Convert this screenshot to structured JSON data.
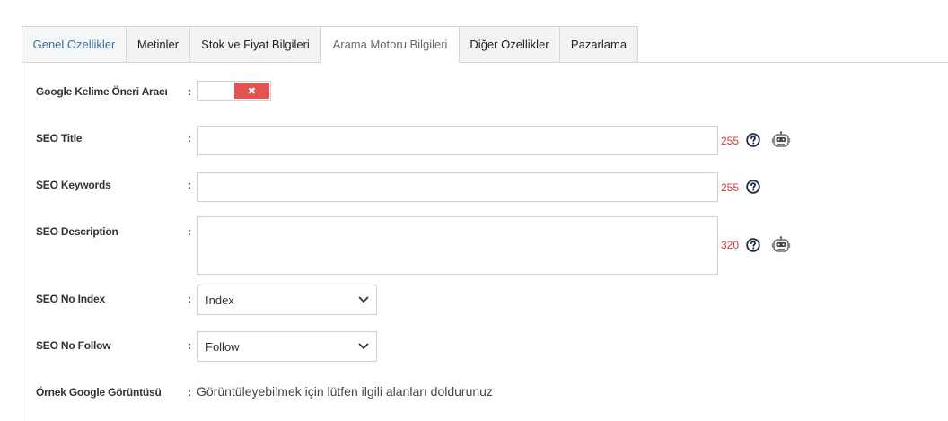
{
  "tabs": [
    {
      "label": "Genel Özellikler"
    },
    {
      "label": "Metinler"
    },
    {
      "label": "Stok ve Fiyat Bilgileri"
    },
    {
      "label": "Arama Motoru Bilgileri"
    },
    {
      "label": "Diğer Özellikler"
    },
    {
      "label": "Pazarlama"
    }
  ],
  "active_tab": "Arama Motoru Bilgileri",
  "form": {
    "colon": ":",
    "keyword_tool": {
      "label": "Google Kelime Öneri Aracı",
      "enabled": false
    },
    "seo_title": {
      "label": "SEO Title",
      "value": "",
      "remaining": "255"
    },
    "seo_keywords": {
      "label": "SEO Keywords",
      "value": "",
      "remaining": "255"
    },
    "seo_description": {
      "label": "SEO Description",
      "value": "",
      "remaining": "320"
    },
    "seo_no_index": {
      "label": "SEO No Index",
      "selected": "Index"
    },
    "seo_no_follow": {
      "label": "SEO No Follow",
      "selected": "Follow"
    },
    "google_preview": {
      "label": "Örnek Google Görüntüsü",
      "message": "Görüntüleyebilmek için lütfen ilgili alanları doldurunuz"
    }
  },
  "colors": {
    "accent_red": "#e45353",
    "counter_red": "#d23b3b",
    "tab_link_blue": "#3f6f9a",
    "icon_navy": "#1f2a4a"
  }
}
